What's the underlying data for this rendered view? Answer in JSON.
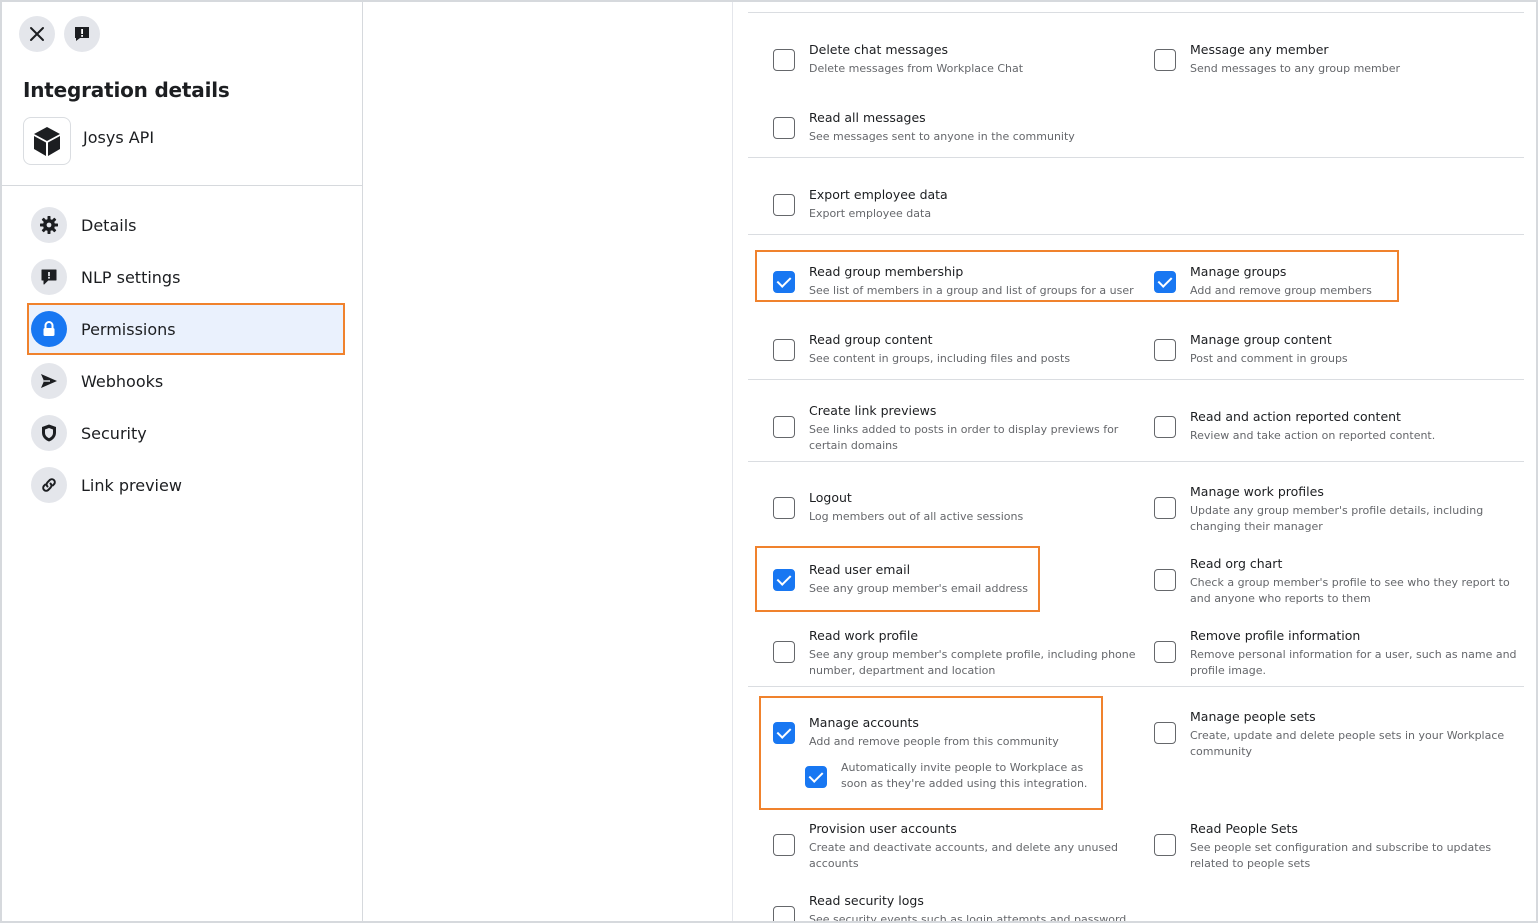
{
  "sidebar": {
    "title": "Integration details",
    "app_name": "Josys API",
    "nav": [
      {
        "label": "Details",
        "icon": "gear-icon"
      },
      {
        "label": "NLP settings",
        "icon": "chat-bubble-icon"
      },
      {
        "label": "Permissions",
        "icon": "lock-icon",
        "active": true
      },
      {
        "label": "Webhooks",
        "icon": "send-icon"
      },
      {
        "label": "Security",
        "icon": "shield-icon"
      },
      {
        "label": "Link preview",
        "icon": "link-icon"
      }
    ]
  },
  "permissions": [
    {
      "title": "Delete chat messages",
      "desc": "Delete messages from Workplace Chat",
      "checked": false
    },
    {
      "title": "Message any member",
      "desc": "Send messages to any group member",
      "checked": false
    },
    {
      "title": "Read all messages",
      "desc": "See messages sent to anyone in the community",
      "checked": false
    },
    {
      "title": "Export employee data",
      "desc": "Export employee data",
      "checked": false
    },
    {
      "title": "Read group membership",
      "desc": "See list of members in a group and list of groups for a user",
      "checked": true
    },
    {
      "title": "Manage groups",
      "desc": "Add and remove group members",
      "checked": true
    },
    {
      "title": "Read group content",
      "desc": "See content in groups, including files and posts",
      "checked": false
    },
    {
      "title": "Manage group content",
      "desc": "Post and comment in groups",
      "checked": false
    },
    {
      "title": "Create link previews",
      "desc": "See links added to posts in order to display previews for certain domains",
      "checked": false
    },
    {
      "title": "Read and action reported content",
      "desc": "Review and take action on reported content.",
      "checked": false
    },
    {
      "title": "Logout",
      "desc": "Log members out of all active sessions",
      "checked": false
    },
    {
      "title": "Manage work profiles",
      "desc": "Update any group member's profile details, including changing their manager",
      "checked": false
    },
    {
      "title": "Read user email",
      "desc": "See any group member's email address",
      "checked": true
    },
    {
      "title": "Read org chart",
      "desc": "Check a group member's profile to see who they report to and anyone who reports to them",
      "checked": false
    },
    {
      "title": "Read work profile",
      "desc": "See any group member's complete profile, including phone number, department and location",
      "checked": false
    },
    {
      "title": "Remove profile information",
      "desc": "Remove personal information for a user, such as name and profile image.",
      "checked": false
    },
    {
      "title": "Manage accounts",
      "desc": "Add and remove people from this community",
      "checked": true
    },
    {
      "title": "Manage people sets",
      "desc": "Create, update and delete people sets in your Workplace community",
      "checked": false
    },
    {
      "title": "Provision user accounts",
      "desc": "Create and deactivate accounts, and delete any unused accounts",
      "checked": false
    },
    {
      "title": "Read People Sets",
      "desc": "See people set configuration and subscribe to updates related to people sets",
      "checked": false
    },
    {
      "title": "Read security logs",
      "desc": "See security events such as login attempts and password",
      "checked": false
    }
  ],
  "sub_option": {
    "desc": "Automatically invite people to Workplace as soon as they're added using this integration.",
    "checked": true
  },
  "colors": {
    "accent": "#1877f2",
    "highlight": "#f0822d"
  }
}
